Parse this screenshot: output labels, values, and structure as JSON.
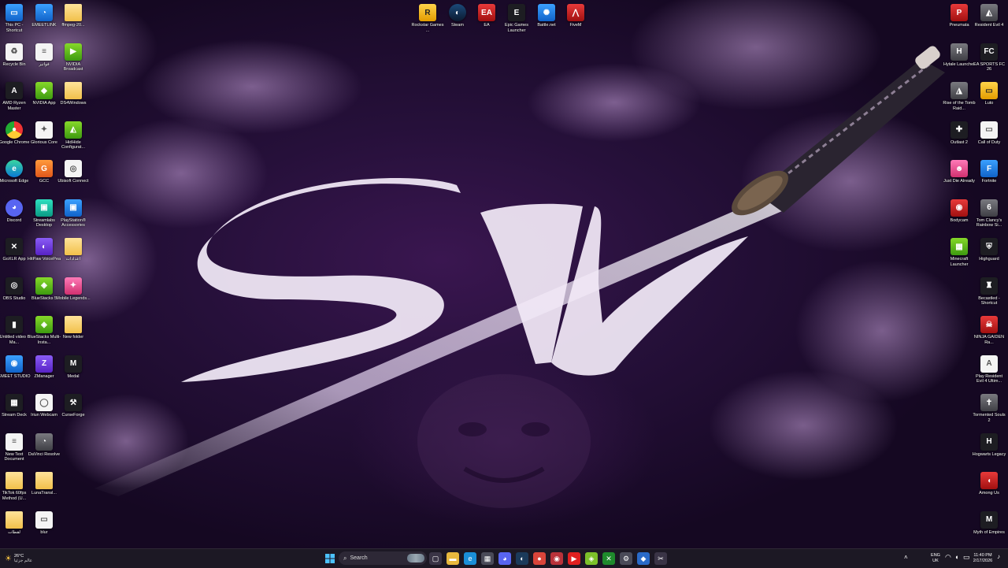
{
  "desktop": {
    "columns": {
      "left1": [
        {
          "label": "This PC - Shortcut",
          "icon": "computer-icon",
          "style": "ic-blue",
          "glyph": "▭"
        },
        {
          "label": "Recycle Bin",
          "icon": "recycle-bin-icon",
          "style": "ic-white",
          "glyph": "♻"
        },
        {
          "label": "AMD Ryzen Master",
          "icon": "amd-ryzen-icon",
          "style": "ic-dark",
          "glyph": "A"
        },
        {
          "label": "Google Chrome",
          "icon": "chrome-icon",
          "style": "ic-chrome",
          "glyph": "●"
        },
        {
          "label": "Microsoft Edge",
          "icon": "edge-icon",
          "style": "ic-edge",
          "glyph": "e"
        },
        {
          "label": "Discord",
          "icon": "discord-icon",
          "style": "ic-discord",
          "glyph": "◕"
        },
        {
          "label": "GoXLR App",
          "icon": "goxlr-icon",
          "style": "ic-dark",
          "glyph": "✕"
        },
        {
          "label": "OBS Studio",
          "icon": "obs-icon",
          "style": "ic-dark",
          "glyph": "◎"
        },
        {
          "label": "Untitled video - Ma...",
          "icon": "video-file-icon",
          "style": "ic-dark",
          "glyph": "▮"
        },
        {
          "label": "EMEET STUDIO",
          "icon": "emeet-studio-icon",
          "style": "ic-blue",
          "glyph": "◉"
        },
        {
          "label": "Stream Deck",
          "icon": "stream-deck-icon",
          "style": "ic-dark",
          "glyph": "▦"
        },
        {
          "label": "New Text Document",
          "icon": "text-document-icon",
          "style": "ic-white",
          "glyph": "≡"
        },
        {
          "label": "TikTok 60fps Method (U...",
          "icon": "folder-icon",
          "style": "ic-folder",
          "glyph": ""
        },
        {
          "label": "لقطات",
          "icon": "folder-icon",
          "style": "ic-folder",
          "glyph": ""
        }
      ],
      "left2": [
        {
          "label": "EMEETLINK",
          "icon": "emeetlink-icon",
          "style": "ic-blue",
          "glyph": "◔"
        },
        {
          "label": "فواتير",
          "icon": "document-icon",
          "style": "ic-white",
          "glyph": "≡"
        },
        {
          "label": "NVIDIA App",
          "icon": "nvidia-icon",
          "style": "ic-green",
          "glyph": "◆"
        },
        {
          "label": "Glorious Core",
          "icon": "glorious-core-icon",
          "style": "ic-white",
          "glyph": "✦"
        },
        {
          "label": "GCC",
          "icon": "gcc-icon",
          "style": "ic-orange",
          "glyph": "G"
        },
        {
          "label": "Streamlabs Desktop",
          "icon": "streamlabs-icon",
          "style": "ic-teal",
          "glyph": "▣"
        },
        {
          "label": "HitPaw VoicePea",
          "icon": "hitpaw-icon",
          "style": "ic-purple",
          "glyph": "◐"
        },
        {
          "label": "BlueStacks 5",
          "icon": "bluestacks-icon",
          "style": "ic-green",
          "glyph": "◈"
        },
        {
          "label": "BlueStacks Multi-Insta...",
          "icon": "bluestacks-multi-icon",
          "style": "ic-green",
          "glyph": "◈"
        },
        {
          "label": "ZManager",
          "icon": "zmanager-icon",
          "style": "ic-purple",
          "glyph": "Z"
        },
        {
          "label": "Iriun Webcam",
          "icon": "webcam-icon",
          "style": "ic-white",
          "glyph": "◯"
        },
        {
          "label": "DaVinci Resolve",
          "icon": "davinci-resolve-icon",
          "style": "ic-gray",
          "glyph": "◔"
        },
        {
          "label": "LunaTransl...",
          "icon": "folder-icon",
          "style": "ic-folder",
          "glyph": ""
        },
        {
          "label": "blur",
          "icon": "blur-file-icon",
          "style": "ic-white",
          "glyph": "▭"
        }
      ],
      "left3": [
        {
          "label": "ffmpeg-20...",
          "icon": "folder-icon",
          "style": "ic-folder",
          "glyph": ""
        },
        {
          "label": "NVIDIA Broadcast",
          "icon": "nvidia-broadcast-icon",
          "style": "ic-green",
          "glyph": "▶"
        },
        {
          "label": "DS4Windows",
          "icon": "folder-icon",
          "style": "ic-folder",
          "glyph": ""
        },
        {
          "label": "HidHide Configurat...",
          "icon": "hidhide-icon",
          "style": "ic-green",
          "glyph": "◭"
        },
        {
          "label": "Ubisoft Connect",
          "icon": "ubisoft-icon",
          "style": "ic-white",
          "glyph": "◎"
        },
        {
          "label": "PlayStation® Accessories",
          "icon": "playstation-icon",
          "style": "ic-blue",
          "glyph": "▣"
        },
        {
          "label": "اعدادات",
          "icon": "folder-icon",
          "style": "ic-folder",
          "glyph": ""
        },
        {
          "label": "Mobile Legends...",
          "icon": "mobile-legends-icon",
          "style": "ic-pink",
          "glyph": "✦"
        },
        {
          "label": "New folder",
          "icon": "folder-icon",
          "style": "ic-folder",
          "glyph": ""
        },
        {
          "label": "Medal",
          "icon": "medal-icon",
          "style": "ic-dark",
          "glyph": "M"
        },
        {
          "label": "CurseForge",
          "icon": "curseforge-icon",
          "style": "ic-dark",
          "glyph": "⚒"
        }
      ],
      "top": [
        {
          "label": "Rockstar Games ...",
          "icon": "rockstar-icon",
          "style": "ic-yellow",
          "glyph": "R"
        },
        {
          "label": "Steam",
          "icon": "steam-icon",
          "style": "ic-steam",
          "glyph": "◐"
        },
        {
          "label": "EA",
          "icon": "ea-icon",
          "style": "ic-red",
          "glyph": "EA"
        },
        {
          "label": "Epic Games Launcher",
          "icon": "epic-games-icon",
          "style": "ic-dark",
          "glyph": "E"
        },
        {
          "label": "Battle.net",
          "icon": "battlenet-icon",
          "style": "ic-blue",
          "glyph": "✺"
        },
        {
          "label": "FiveM",
          "icon": "fivem-icon",
          "style": "ic-red",
          "glyph": "⋀"
        }
      ],
      "right1": [
        {
          "label": "Pneumata",
          "icon": "pneumata-icon",
          "style": "ic-red",
          "glyph": "P"
        },
        {
          "label": "Hytale Launcher",
          "icon": "hytale-icon",
          "style": "ic-gray",
          "glyph": "H"
        },
        {
          "label": "Rise of the Tomb Raid...",
          "icon": "tomb-raider-icon",
          "style": "ic-gray",
          "glyph": "◮"
        },
        {
          "label": "Outlast 2",
          "icon": "outlast-icon",
          "style": "ic-dark",
          "glyph": "✚"
        },
        {
          "label": "Just Die Already",
          "icon": "just-die-already-icon",
          "style": "ic-pink",
          "glyph": "☻"
        },
        {
          "label": "Bodycam",
          "icon": "bodycam-icon",
          "style": "ic-red",
          "glyph": "◉"
        },
        {
          "label": "Minecraft Launcher",
          "icon": "minecraft-icon",
          "style": "ic-green",
          "glyph": "▦"
        }
      ],
      "right2": [
        {
          "label": "Resident Evil 4",
          "icon": "resident-evil-icon",
          "style": "ic-gray",
          "glyph": "◭"
        },
        {
          "label": "EA SPORTS FC 26",
          "icon": "ea-sports-fc-icon",
          "style": "ic-dark",
          "glyph": "FC"
        },
        {
          "label": "Luto",
          "icon": "luto-icon",
          "style": "ic-yellow",
          "glyph": "▭"
        },
        {
          "label": "Call of Duty",
          "icon": "call-of-duty-icon",
          "style": "ic-white",
          "glyph": "▭"
        },
        {
          "label": "Fortnite",
          "icon": "fortnite-icon",
          "style": "ic-blue",
          "glyph": "F"
        },
        {
          "label": "Tom Clancy's Rainbow Si...",
          "icon": "rainbow-six-icon",
          "style": "ic-gray",
          "glyph": "6"
        },
        {
          "label": "Highguard",
          "icon": "highguard-icon",
          "style": "ic-dark",
          "glyph": "⛨"
        },
        {
          "label": "Becastled - Shortcut",
          "icon": "becastled-icon",
          "style": "ic-dark",
          "glyph": "♜"
        },
        {
          "label": "NINJA GAIDEN Ra...",
          "icon": "ninja-gaiden-icon",
          "style": "ic-red",
          "glyph": "☠"
        },
        {
          "label": "Play Resident Evil 4 Ultim...",
          "icon": "resident-evil-play-icon",
          "style": "ic-white",
          "glyph": "A"
        },
        {
          "label": "Tormented Souls 2",
          "icon": "tormented-souls-icon",
          "style": "ic-gray",
          "glyph": "✝"
        },
        {
          "label": "Hogwarts Legacy",
          "icon": "hogwarts-legacy-icon",
          "style": "ic-dark",
          "glyph": "H"
        },
        {
          "label": "Among Us",
          "icon": "among-us-icon",
          "style": "ic-red",
          "glyph": "◖"
        },
        {
          "label": "Myth of Empires",
          "icon": "myth-of-empires-icon",
          "style": "ic-dark",
          "glyph": "M"
        }
      ]
    }
  },
  "taskbar": {
    "weather": {
      "temp": "26°C",
      "desc": "عالم جزئيا",
      "icon": "weather-sun-icon"
    },
    "search_label": "Search",
    "pinned": [
      {
        "name": "task-view-icon",
        "glyph": "▢",
        "color": "#3a3446"
      },
      {
        "name": "file-explorer-icon",
        "glyph": "▬",
        "color": "#e8b93e"
      },
      {
        "name": "edge-icon",
        "glyph": "e",
        "color": "#1a8fd8"
      },
      {
        "name": "store-icon",
        "glyph": "▦",
        "color": "#4a4a58"
      },
      {
        "name": "discord-icon",
        "glyph": "◕",
        "color": "#5865f2"
      },
      {
        "name": "steam-icon",
        "glyph": "◐",
        "color": "#1b3a5a"
      },
      {
        "name": "chrome-icon",
        "glyph": "●",
        "color": "#d9453a"
      },
      {
        "name": "recorder-icon",
        "glyph": "◉",
        "color": "#b8323a"
      },
      {
        "name": "youtube-icon",
        "glyph": "▶",
        "color": "#e02020"
      },
      {
        "name": "bluestacks-icon",
        "glyph": "◈",
        "color": "#7cc12a"
      },
      {
        "name": "xbox-icon",
        "glyph": "✕",
        "color": "#1f8a2c"
      },
      {
        "name": "settings-gear-icon",
        "glyph": "⚙",
        "color": "#4a4a58"
      },
      {
        "name": "app-icon",
        "glyph": "◆",
        "color": "#2a6ac8"
      },
      {
        "name": "snipping-tool-icon",
        "glyph": "✂",
        "color": "#3a3446"
      }
    ],
    "tray": {
      "lang_top": "ENG",
      "lang_bottom": "UK",
      "time": "11:40 PM",
      "date": "2/17/2026"
    }
  }
}
